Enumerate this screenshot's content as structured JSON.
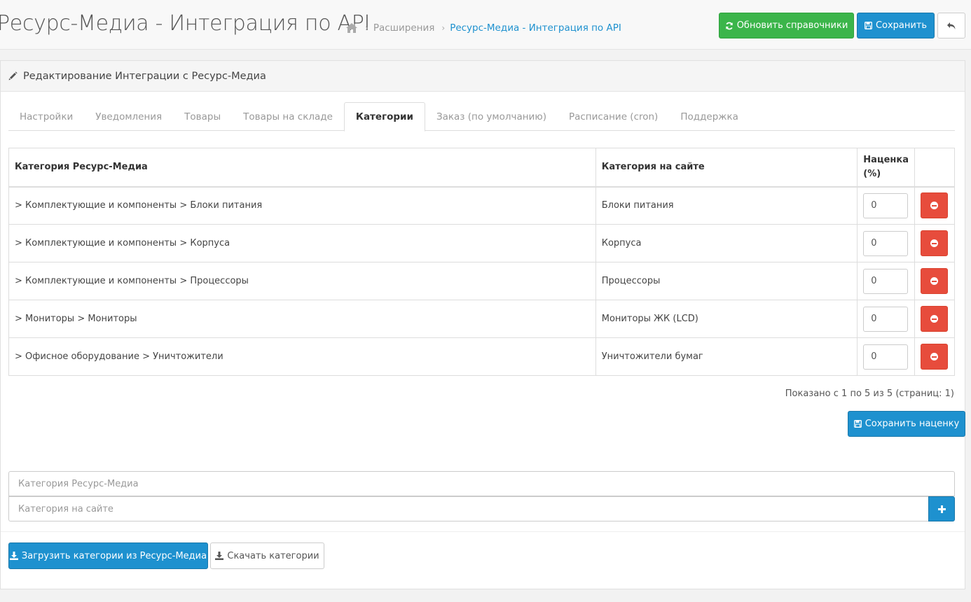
{
  "header": {
    "title": "Ресурс-Медиа - Интеграция по API",
    "breadcrumb": [
      {
        "label": "Расширения"
      },
      {
        "label": "Ресурс-Медиа - Интеграция по API"
      }
    ],
    "refresh_button": "Обновить справочники",
    "save_button": "Сохранить",
    "back_icon": "reply-icon"
  },
  "panel": {
    "heading": "Редактирование Интеграции с Ресурс-Медиа",
    "tabs": [
      {
        "label": "Настройки"
      },
      {
        "label": "Уведомления"
      },
      {
        "label": "Товары"
      },
      {
        "label": "Товары на складе"
      },
      {
        "label": "Категории",
        "active": true
      },
      {
        "label": "Заказ (по умолчанию)"
      },
      {
        "label": "Расписание (cron)"
      },
      {
        "label": "Поддержка"
      }
    ]
  },
  "table": {
    "headers": {
      "rm_category": "Категория Ресурс-Медиа",
      "site_category": "Категория на сайте",
      "markup": "Наценка (%)"
    },
    "rows": [
      {
        "rm": "> Комплектующие и компоненты > Блоки питания",
        "site": "Блоки питания",
        "markup": "0"
      },
      {
        "rm": "> Комплектующие и компоненты > Корпуса",
        "site": "Корпуса",
        "markup": "0"
      },
      {
        "rm": "> Комплектующие и компоненты > Процессоры",
        "site": "Процессоры",
        "markup": "0"
      },
      {
        "rm": "> Мониторы > Мониторы",
        "site": "Мониторы ЖК (LCD)",
        "markup": "0"
      },
      {
        "rm": "> Офисное оборудование > Уничтожители",
        "site": "Уничтожители бумаг",
        "markup": "0"
      }
    ]
  },
  "pagination_info": "Показано с 1 по 5 из 5 (страниц: 1)",
  "save_markup_button": "Сохранить наценку",
  "form": {
    "rm_placeholder": "Категория Ресурс-Медиа",
    "site_placeholder": "Категория на сайте"
  },
  "load_button": "Загрузить категории из Ресурс-Медиа",
  "download_button": "Скачать категории",
  "colors": {
    "green": "#3bb54a",
    "blue": "#1e91cf",
    "red": "#e74c3c"
  }
}
